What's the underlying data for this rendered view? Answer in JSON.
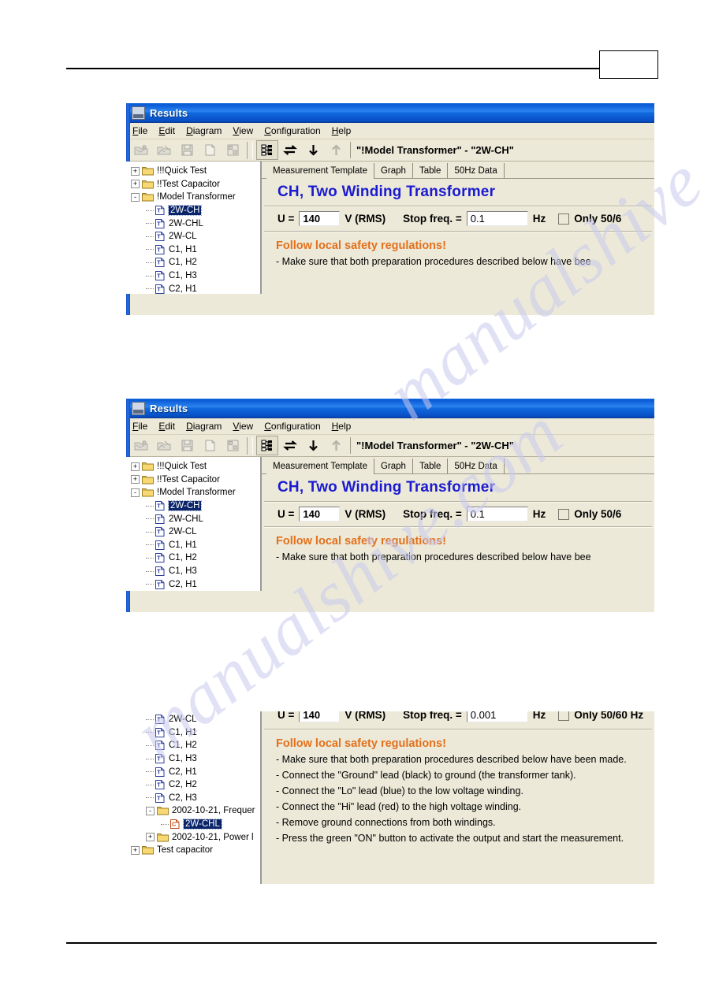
{
  "page": {
    "number": "",
    "watermark": "manualshive.com"
  },
  "window": {
    "title": "Results",
    "icon": "results-window-icon",
    "menu": [
      {
        "label": "File",
        "accel": "F"
      },
      {
        "label": "Edit",
        "accel": "E"
      },
      {
        "label": "Diagram",
        "accel": "D"
      },
      {
        "label": "View",
        "accel": "V"
      },
      {
        "label": "Configuration",
        "accel": "C"
      },
      {
        "label": "Help",
        "accel": "H"
      }
    ],
    "toolbar": {
      "buttons": [
        {
          "name": "open-measurement-icon",
          "enabled": false
        },
        {
          "name": "open-template-icon",
          "enabled": false
        },
        {
          "name": "save-icon",
          "enabled": false
        },
        {
          "name": "new-document-icon",
          "enabled": false
        },
        {
          "name": "export-icon",
          "enabled": false
        },
        {
          "name": "tree-view-icon",
          "enabled": true
        },
        {
          "name": "swap-arrows-icon",
          "enabled": true
        },
        {
          "name": "down-arrow-icon",
          "enabled": true
        },
        {
          "name": "up-arrow-icon",
          "enabled": false
        }
      ],
      "address": "\"!Model Transformer\" - \"2W-CH\""
    },
    "tabs": [
      {
        "label": "Measurement Template",
        "active": true
      },
      {
        "label": "Graph",
        "active": false
      },
      {
        "label": "Table",
        "active": false
      },
      {
        "label": "50Hz Data",
        "active": false
      }
    ],
    "panel": {
      "title": "CH, Two Winding Transformer",
      "u_label": "U =",
      "u_value": "140",
      "u_unit": "V (RMS)",
      "stop_label": "Stop freq. =",
      "stop_value_top": "0.1",
      "stop_value_bottom": "0.001",
      "stop_unit": "Hz",
      "only_checkbox_label": "Only 50/6",
      "only_checkbox_label_full": "Only 50/60 Hz",
      "safety_heading": "Follow local safety regulations!",
      "bullets": [
        "- Make sure that both preparation procedures described below have bee",
        "- Connect the \"Ground\" lead (black) to ground (the transformer tank).",
        "- Connect the \"Lo\" lead (blue) to the low voltage winding.",
        "- Connect the \"Hi\" lead (red) to the high voltage winding.",
        "- Remove ground connections from both windings.",
        "- Press the green \"ON\" button to activate the output and start the measurement."
      ],
      "bullets_full": [
        "- Make sure that both preparation procedures described below have been made."
      ]
    },
    "tree_top": [
      {
        "label": "!!!Quick Test",
        "type": "folder",
        "depth": 0,
        "toggle": "+",
        "selected": false
      },
      {
        "label": "!!Test Capacitor",
        "type": "folder",
        "depth": 0,
        "toggle": "+",
        "selected": false
      },
      {
        "label": "!Model Transformer",
        "type": "folder",
        "depth": 0,
        "toggle": "-",
        "selected": false
      },
      {
        "label": "2W-CH",
        "type": "doc",
        "depth": 1,
        "toggle": "",
        "selected": true
      },
      {
        "label": "2W-CHL",
        "type": "doc",
        "depth": 1,
        "toggle": "",
        "selected": false
      },
      {
        "label": "2W-CL",
        "type": "doc",
        "depth": 1,
        "toggle": "",
        "selected": false
      },
      {
        "label": "C1, H1",
        "type": "doc",
        "depth": 1,
        "toggle": "",
        "selected": false
      },
      {
        "label": "C1, H2",
        "type": "doc",
        "depth": 1,
        "toggle": "",
        "selected": false
      },
      {
        "label": "C1, H3",
        "type": "doc",
        "depth": 1,
        "toggle": "",
        "selected": false
      },
      {
        "label": "C2, H1",
        "type": "doc",
        "depth": 1,
        "toggle": "",
        "selected": false
      },
      {
        "label": "C2, H2",
        "type": "doc",
        "depth": 1,
        "toggle": "",
        "selected": false
      }
    ],
    "tree_bottom": [
      {
        "label": "2W-CL",
        "type": "doc",
        "depth": 1,
        "toggle": "",
        "selected": false
      },
      {
        "label": "C1, H1",
        "type": "doc",
        "depth": 1,
        "toggle": "",
        "selected": false
      },
      {
        "label": "C1, H2",
        "type": "doc",
        "depth": 1,
        "toggle": "",
        "selected": false
      },
      {
        "label": "C1, H3",
        "type": "doc",
        "depth": 1,
        "toggle": "",
        "selected": false
      },
      {
        "label": "C2, H1",
        "type": "doc",
        "depth": 1,
        "toggle": "",
        "selected": false
      },
      {
        "label": "C2, H2",
        "type": "doc",
        "depth": 1,
        "toggle": "",
        "selected": false
      },
      {
        "label": "C2, H3",
        "type": "doc",
        "depth": 1,
        "toggle": "",
        "selected": false
      },
      {
        "label": "2002-10-21, Frequer",
        "type": "folder",
        "depth": 1,
        "toggle": "-",
        "selected": false
      },
      {
        "label": "2W-CHL",
        "type": "result",
        "depth": 2,
        "toggle": "",
        "selected": true
      },
      {
        "label": "2002-10-21, Power l",
        "type": "folder",
        "depth": 1,
        "toggle": "+",
        "selected": false
      },
      {
        "label": "Test capacitor",
        "type": "folder",
        "depth": 0,
        "toggle": "+",
        "selected": false
      }
    ]
  },
  "colors": {
    "titlebar_blue": "#0a5ad6",
    "panel_bg": "#ece9d8",
    "heading_blue": "#1a1ad0",
    "safety_orange": "#e3701b",
    "selection_navy": "#0a246a",
    "folder_yellow": "#f7d66b",
    "watermark_lavender": "#c9c9ef"
  }
}
